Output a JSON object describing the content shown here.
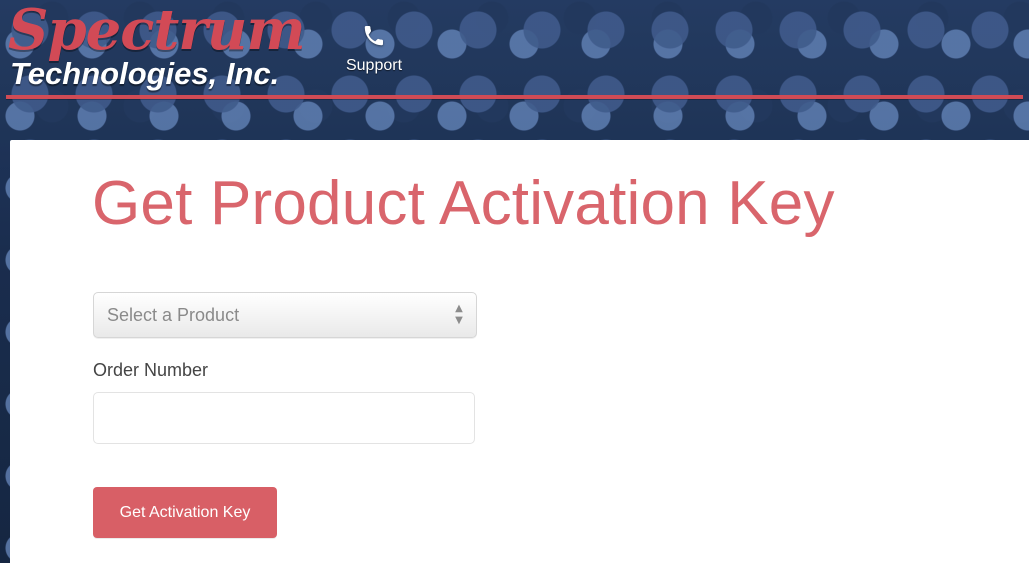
{
  "header": {
    "logo": {
      "line1": "Spectrum",
      "line2": "Technologies, Inc."
    },
    "support": {
      "label": "Support",
      "icon": "phone-icon"
    },
    "accent_line_color": "#d04b55"
  },
  "main": {
    "title": "Get Product Activation Key",
    "product_select": {
      "selected_value": "Select a Product"
    },
    "order_number": {
      "label": "Order Number",
      "value": "",
      "placeholder": ""
    },
    "submit_button": {
      "label": "Get Activation Key"
    }
  },
  "colors": {
    "title": "#d9656c",
    "button": "#d85f66",
    "logo_red": "#d24a56"
  }
}
